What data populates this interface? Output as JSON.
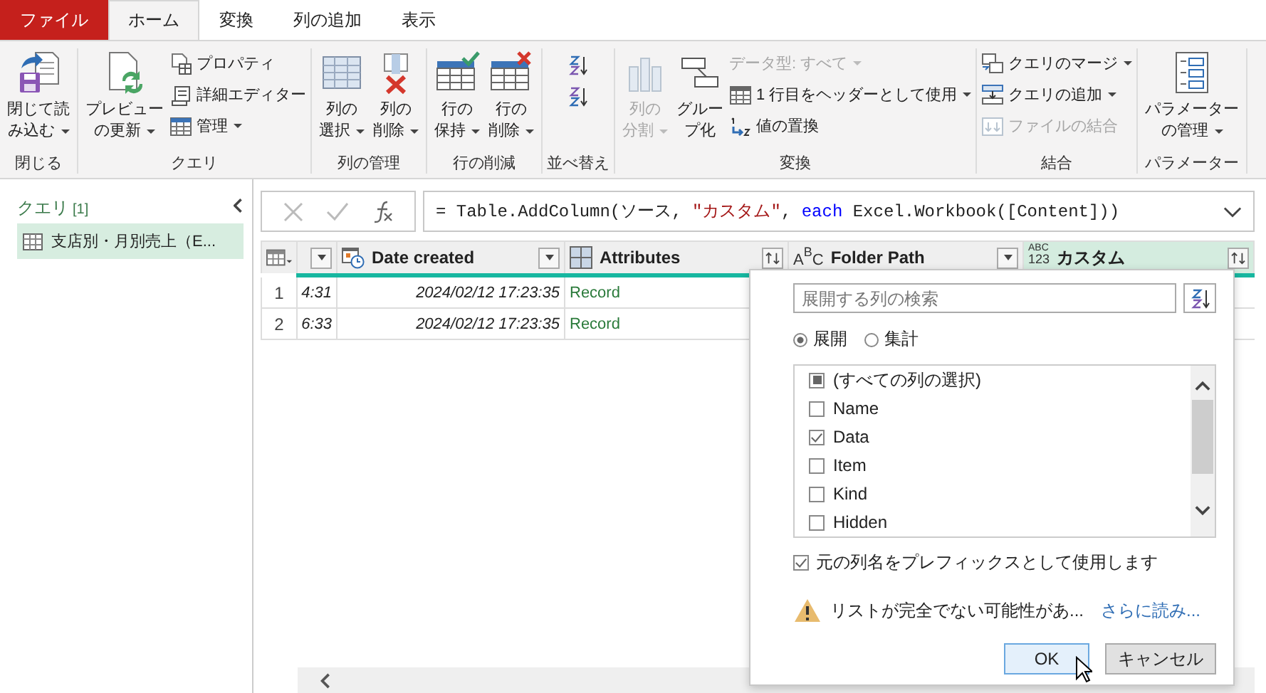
{
  "tabs": [
    {
      "label": "ファイル",
      "kind": "file",
      "selected": false
    },
    {
      "label": "ホーム",
      "kind": "tab",
      "selected": true
    },
    {
      "label": "変換",
      "kind": "tab",
      "selected": false
    },
    {
      "label": "列の追加",
      "kind": "tab",
      "selected": false
    },
    {
      "label": "表示",
      "kind": "tab",
      "selected": false
    }
  ],
  "ribbon": {
    "groups": [
      {
        "label": "閉じる",
        "columns": [
          {
            "kind": "large",
            "lines": [
              "閉じて読",
              "み込む"
            ],
            "dropdown": true,
            "disabled": false
          }
        ]
      },
      {
        "label": "クエリ",
        "columns": [
          {
            "kind": "large",
            "lines": [
              "プレビュー",
              "の更新"
            ],
            "dropdown": true,
            "disabled": false
          },
          {
            "kind": "stack",
            "items": [
              {
                "label": "プロパティ",
                "dropdown": false,
                "disabled": false
              },
              {
                "label": "詳細エディター",
                "dropdown": false,
                "disabled": false
              },
              {
                "label": "管理",
                "dropdown": true,
                "disabled": false
              }
            ]
          }
        ]
      },
      {
        "label": "列の管理",
        "columns": [
          {
            "kind": "large",
            "lines": [
              "列の",
              "選択"
            ],
            "dropdown": true,
            "disabled": false
          },
          {
            "kind": "large",
            "lines": [
              "列の",
              "削除"
            ],
            "dropdown": true,
            "disabled": false
          }
        ]
      },
      {
        "label": "行の削減",
        "columns": [
          {
            "kind": "large",
            "lines": [
              "行の",
              "保持"
            ],
            "dropdown": true,
            "disabled": false
          },
          {
            "kind": "large",
            "lines": [
              "行の",
              "削除"
            ],
            "dropdown": true,
            "disabled": false
          }
        ]
      },
      {
        "label": "並べ替え",
        "columns": [
          {
            "kind": "sort"
          }
        ]
      },
      {
        "label": "変換",
        "columns": [
          {
            "kind": "large",
            "lines": [
              "列の",
              "分割"
            ],
            "dropdown": true,
            "disabled": true
          },
          {
            "kind": "large",
            "lines": [
              "グルー",
              "プ化"
            ],
            "dropdown": false,
            "disabled": false
          },
          {
            "kind": "stack",
            "items": [
              {
                "label": "データ型: すべて",
                "dropdown": true,
                "disabled": true
              },
              {
                "label": "1 行目をヘッダーとして使用",
                "dropdown": true,
                "disabled": false
              },
              {
                "label": "値の置換",
                "dropdown": false,
                "disabled": false
              }
            ]
          }
        ]
      },
      {
        "label": "結合",
        "columns": [
          {
            "kind": "stack",
            "items": [
              {
                "label": "クエリのマージ",
                "dropdown": true,
                "disabled": false
              },
              {
                "label": "クエリの追加",
                "dropdown": true,
                "disabled": false
              },
              {
                "label": "ファイルの結合",
                "dropdown": false,
                "disabled": true
              }
            ]
          }
        ]
      },
      {
        "label": "パラメーター",
        "columns": [
          {
            "kind": "large",
            "lines": [
              "パラメーター",
              "の管理"
            ],
            "dropdown": true,
            "disabled": false
          }
        ]
      }
    ]
  },
  "queries": {
    "title": "クエリ",
    "count": "[1]",
    "items": [
      {
        "label": "支店別・月別売上（E...",
        "selected": true
      }
    ]
  },
  "formula": {
    "parts": [
      {
        "text": "= Table.AddColumn(ソース, ",
        "kind": "plain"
      },
      {
        "text": "\"カスタム\"",
        "kind": "string"
      },
      {
        "text": ", ",
        "kind": "plain"
      },
      {
        "text": "each",
        "kind": "keyword"
      },
      {
        "text": " Excel.Workbook([Content]))",
        "kind": "plain"
      }
    ]
  },
  "table": {
    "columns": [
      {
        "kind": "cut",
        "expandable": false,
        "selected": false
      },
      {
        "name": "Date created",
        "kind": "datetime",
        "expandable": false,
        "selected": false
      },
      {
        "name": "Attributes",
        "kind": "record",
        "expandable": true,
        "selected": false
      },
      {
        "name": "Folder Path",
        "kind": "text",
        "type_glyph": [
          "A",
          "B",
          "C"
        ],
        "expandable": false,
        "selected": false
      },
      {
        "name": "カスタム",
        "kind": "any",
        "type_glyph": [
          "ABC",
          "123"
        ],
        "expandable": true,
        "selected": true
      }
    ],
    "rows": [
      {
        "index": "1",
        "cells": [
          "4:31",
          "2024/02/12 17:23:35",
          "Record"
        ]
      },
      {
        "index": "2",
        "cells": [
          "6:33",
          "2024/02/12 17:23:35",
          "Record"
        ]
      }
    ]
  },
  "expand_popup": {
    "search": {
      "placeholder": "展開する列の検索"
    },
    "modes": [
      {
        "label": "展開",
        "selected": true
      },
      {
        "label": "集計",
        "selected": false
      }
    ],
    "select_all": {
      "label": "(すべての列の選択)",
      "partial": true
    },
    "columns": [
      {
        "label": "Name",
        "checked": false
      },
      {
        "label": "Data",
        "checked": true
      },
      {
        "label": "Item",
        "checked": false
      },
      {
        "label": "Kind",
        "checked": false
      },
      {
        "label": "Hidden",
        "checked": false
      }
    ],
    "prefix": {
      "label": "元の列名をプレフィックスとして使用します",
      "checked": true
    },
    "warning": {
      "text": "リストが完全でない可能性があ...",
      "link": "さらに読み..."
    },
    "buttons": [
      {
        "label": "OK",
        "default": true
      },
      {
        "label": "キャンセル",
        "default": false
      }
    ]
  }
}
